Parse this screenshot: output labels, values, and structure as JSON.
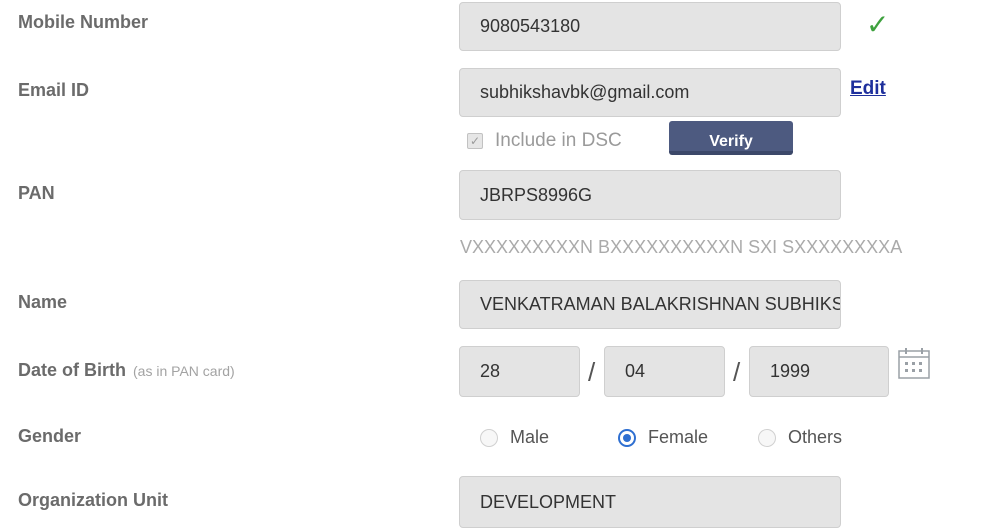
{
  "form": {
    "mobile": {
      "label": "Mobile Number",
      "value": "9080543180",
      "verified_icon": "check-icon"
    },
    "email": {
      "label": "Email ID",
      "value": "subhikshavbk@gmail.com",
      "edit_label": "Edit"
    },
    "dsc": {
      "label": "Include in DSC",
      "checked": true
    },
    "verify_button": "Verify",
    "pan": {
      "label": "PAN",
      "value": "JBRPS8996G",
      "name_on_pan": "VXXXXXXXXXN BXXXXXXXXXXN SXI SXXXXXXXXA"
    },
    "name": {
      "label": "Name",
      "value": "VENKATRAMAN BALAKRISHNAN SUBHIKSHA"
    },
    "dob": {
      "label": "Date of Birth",
      "hint": "(as in PAN card)",
      "day": "28",
      "month": "04",
      "year": "1999",
      "separator": "/"
    },
    "gender": {
      "label": "Gender",
      "options": [
        "Male",
        "Female",
        "Others"
      ],
      "selected": "Female"
    },
    "org_unit": {
      "label": "Organization Unit",
      "value": "DEVELOPMENT"
    }
  },
  "colors": {
    "accent": "#2e6fd1",
    "verify_button": "#4d5a80",
    "link": "#1e2f9c",
    "success": "#3ea13e"
  }
}
